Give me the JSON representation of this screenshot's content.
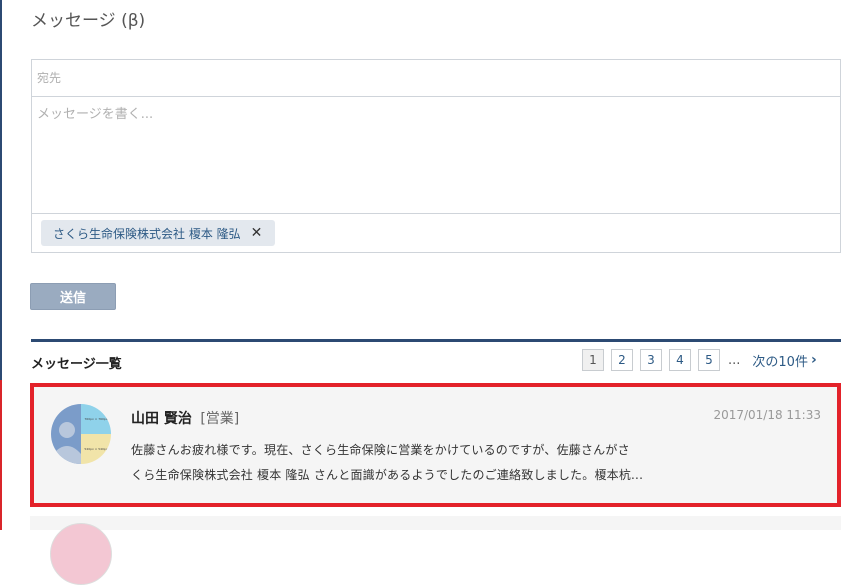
{
  "page": {
    "title": "メッセージ (β)"
  },
  "compose": {
    "to_placeholder": "宛先",
    "body_placeholder": "メッセージを書く...",
    "recipients": [
      {
        "label": "さくら生命保険株式会社 榎本 隆弘"
      }
    ],
    "remove_icon": "close-icon"
  },
  "send_button": {
    "label": "送信",
    "color": "#9aabc0"
  },
  "message_list": {
    "title": "メッセージ一覧",
    "pagination": {
      "pages": [
        "1",
        "2",
        "3",
        "4",
        "5"
      ],
      "current": "1",
      "ellipsis": "...",
      "next_label": "次の10件",
      "next_icon": "chevron-right-icon"
    },
    "messages": [
      {
        "sender": "山田 賢治",
        "department": "[営業]",
        "timestamp": "2017/01/18 11:33",
        "body_line1": "佐藤さんお疲れ様です。現在、さくら生命保険に営業をかけているのですが、佐藤さんがさ",
        "body_line2": "くら生命保険株式会社 榎本 隆弘 さんと面識があるようでしたのご連絡致しました。榎本杭...",
        "avatar": {
          "icon": "avatar-image",
          "label_top": "760px × 760px",
          "label_bottom": "540px × 540px"
        }
      }
    ]
  },
  "colors": {
    "accent": "#2c4a73",
    "highlight": "#e3222a",
    "link": "#2d5a85"
  }
}
